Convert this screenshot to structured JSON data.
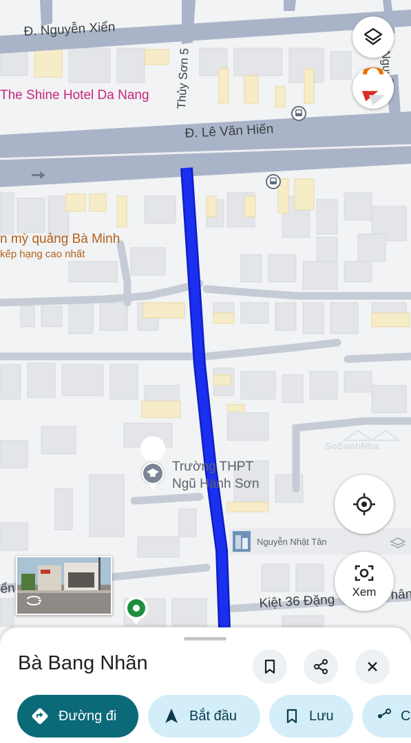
{
  "map": {
    "streets": {
      "nguyen_xien": "Đ. Nguyễn Xiển",
      "le_van_hien": "Đ. Lê Văn Hiến",
      "thuy_son_5": "Thủy Sơn 5",
      "van_nguyen": "Văn Nguyễn",
      "kiet_36": "Kiệt 36 Đặng",
      "kiet_36_tail": "hân",
      "left_edge": "ển"
    },
    "pois": {
      "shine_hotel": "The Shine Hotel Da Nang",
      "ba_minh": "n mỳ quảng Bà Minh",
      "ba_minh_sub": "kếp hạng cao nhất",
      "school_line1": "Trường THPT",
      "school_line2": "Ngũ Hành Sơn"
    },
    "photo_pin_label": "Nguyễn Nhật Tân",
    "watermark": "SoSanhNha",
    "route_color": "#1a2ff0",
    "road_color": "#aab4c8"
  },
  "controls": {
    "layers_icon": "layers-icon",
    "compass_icon": "compass-icon",
    "location_icon": "my-location-icon",
    "lens_icon": "camera-lens-icon",
    "lens_label": "Xem"
  },
  "sheet": {
    "title": "Bà Bang Nhãn",
    "save_icon": "bookmark-icon",
    "share_icon": "share-icon",
    "close_icon": "close-icon",
    "chips": [
      {
        "label": "Đường đi",
        "icon": "directions-icon"
      },
      {
        "label": "Bắt đầu",
        "icon": "navigation-arrow-icon"
      },
      {
        "label": "Lưu",
        "icon": "bookmark-icon"
      },
      {
        "label": "C",
        "icon": "share-icon"
      }
    ]
  }
}
